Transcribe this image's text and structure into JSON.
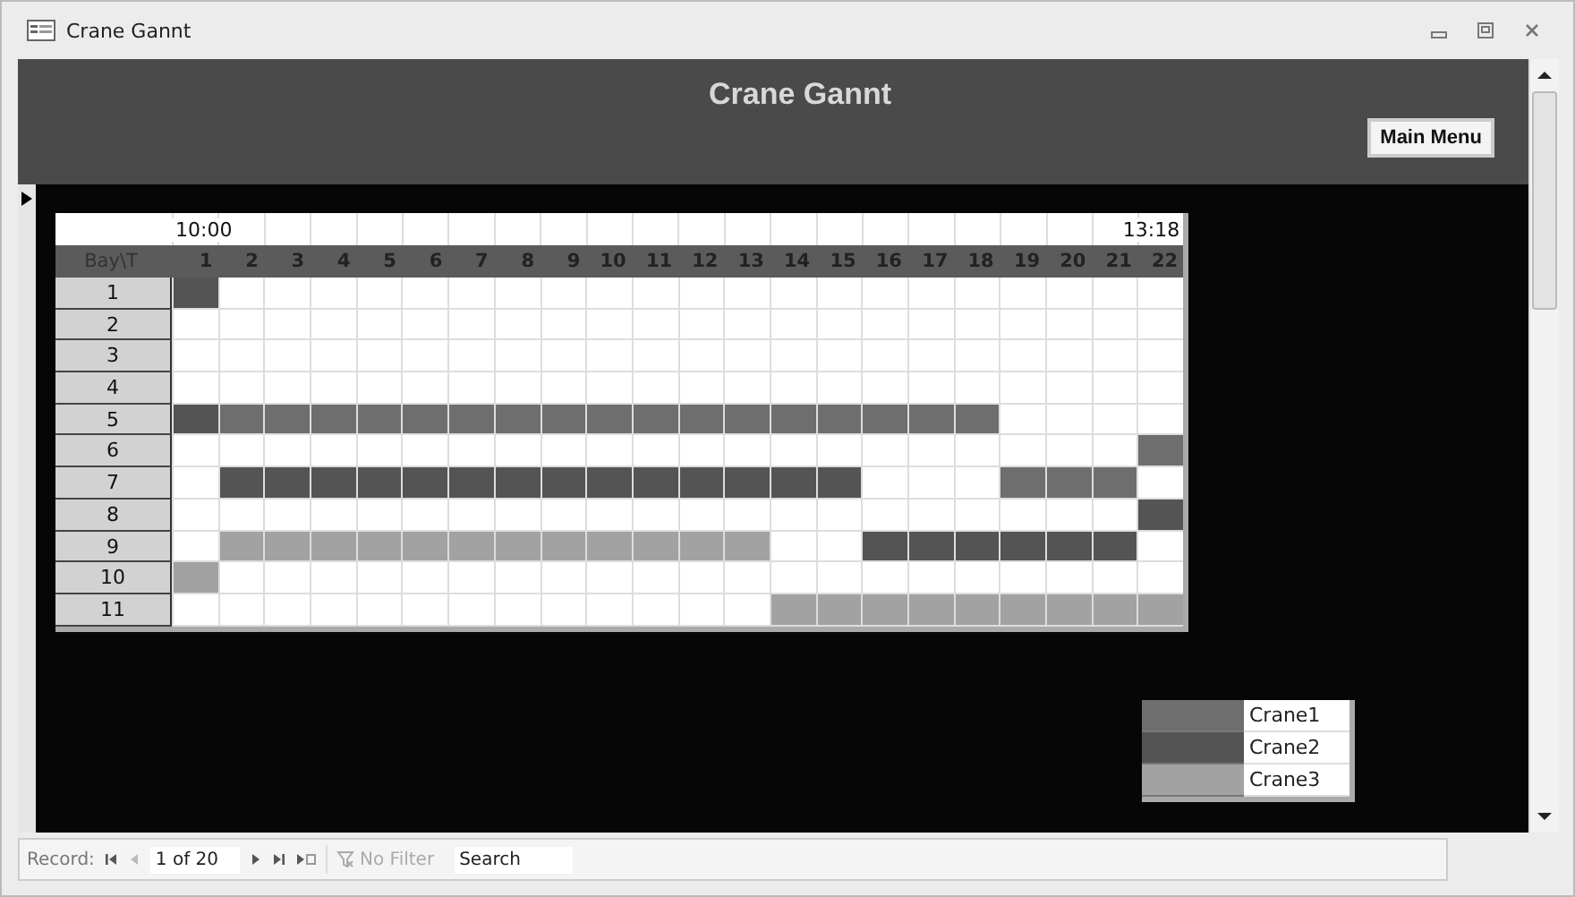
{
  "window": {
    "title": "Crane Gannt"
  },
  "header": {
    "title": "Crane Gannt",
    "button": "Main Menu"
  },
  "gantt": {
    "corner": "Bay\\T",
    "start_time": "10:00",
    "end_time": "13:18",
    "columns": [
      "1",
      "2",
      "3",
      "4",
      "5",
      "6",
      "7",
      "8",
      "9",
      "10",
      "11",
      "12",
      "13",
      "14",
      "15",
      "16",
      "17",
      "18",
      "19",
      "20",
      "21",
      "22"
    ],
    "rows": [
      {
        "label": "1",
        "cells": [
          {
            "color": "#545454"
          },
          {
            "color": "#ffffff"
          },
          {
            "color": "#ffffff"
          },
          {
            "color": "#ffffff"
          },
          {
            "color": "#ffffff"
          },
          {
            "color": "#ffffff"
          },
          {
            "color": "#ffffff"
          },
          {
            "color": "#ffffff"
          },
          {
            "color": "#ffffff"
          },
          {
            "color": "#ffffff"
          },
          {
            "color": "#ffffff"
          },
          {
            "color": "#ffffff"
          },
          {
            "color": "#ffffff"
          },
          {
            "color": "#ffffff"
          },
          {
            "color": "#ffffff"
          },
          {
            "color": "#ffffff"
          },
          {
            "color": "#ffffff"
          },
          {
            "color": "#ffffff"
          },
          {
            "color": "#ffffff"
          },
          {
            "color": "#ffffff"
          },
          {
            "color": "#ffffff"
          },
          {
            "color": "#ffffff"
          }
        ]
      },
      {
        "label": "2",
        "cells": [
          {
            "color": "#ffffff"
          },
          {
            "color": "#ffffff"
          },
          {
            "color": "#ffffff"
          },
          {
            "color": "#ffffff"
          },
          {
            "color": "#ffffff"
          },
          {
            "color": "#ffffff"
          },
          {
            "color": "#ffffff"
          },
          {
            "color": "#ffffff"
          },
          {
            "color": "#ffffff"
          },
          {
            "color": "#ffffff"
          },
          {
            "color": "#ffffff"
          },
          {
            "color": "#ffffff"
          },
          {
            "color": "#ffffff"
          },
          {
            "color": "#ffffff"
          },
          {
            "color": "#ffffff"
          },
          {
            "color": "#ffffff"
          },
          {
            "color": "#ffffff"
          },
          {
            "color": "#ffffff"
          },
          {
            "color": "#ffffff"
          },
          {
            "color": "#ffffff"
          },
          {
            "color": "#ffffff"
          },
          {
            "color": "#ffffff"
          }
        ]
      },
      {
        "label": "3",
        "cells": [
          {
            "color": "#ffffff"
          },
          {
            "color": "#ffffff"
          },
          {
            "color": "#ffffff"
          },
          {
            "color": "#ffffff"
          },
          {
            "color": "#ffffff"
          },
          {
            "color": "#ffffff"
          },
          {
            "color": "#ffffff"
          },
          {
            "color": "#ffffff"
          },
          {
            "color": "#ffffff"
          },
          {
            "color": "#ffffff"
          },
          {
            "color": "#ffffff"
          },
          {
            "color": "#ffffff"
          },
          {
            "color": "#ffffff"
          },
          {
            "color": "#ffffff"
          },
          {
            "color": "#ffffff"
          },
          {
            "color": "#ffffff"
          },
          {
            "color": "#ffffff"
          },
          {
            "color": "#ffffff"
          },
          {
            "color": "#ffffff"
          },
          {
            "color": "#ffffff"
          },
          {
            "color": "#ffffff"
          },
          {
            "color": "#ffffff"
          }
        ]
      },
      {
        "label": "4",
        "cells": [
          {
            "color": "#ffffff"
          },
          {
            "color": "#ffffff"
          },
          {
            "color": "#ffffff"
          },
          {
            "color": "#ffffff"
          },
          {
            "color": "#ffffff"
          },
          {
            "color": "#ffffff"
          },
          {
            "color": "#ffffff"
          },
          {
            "color": "#ffffff"
          },
          {
            "color": "#ffffff"
          },
          {
            "color": "#ffffff"
          },
          {
            "color": "#ffffff"
          },
          {
            "color": "#ffffff"
          },
          {
            "color": "#ffffff"
          },
          {
            "color": "#ffffff"
          },
          {
            "color": "#ffffff"
          },
          {
            "color": "#ffffff"
          },
          {
            "color": "#ffffff"
          },
          {
            "color": "#ffffff"
          },
          {
            "color": "#ffffff"
          },
          {
            "color": "#ffffff"
          },
          {
            "color": "#ffffff"
          },
          {
            "color": "#ffffff"
          }
        ]
      },
      {
        "label": "5",
        "cells": [
          {
            "color": "#545454"
          },
          {
            "color": "#6e6e6e"
          },
          {
            "color": "#6e6e6e"
          },
          {
            "color": "#6e6e6e"
          },
          {
            "color": "#6e6e6e"
          },
          {
            "color": "#6e6e6e"
          },
          {
            "color": "#6e6e6e"
          },
          {
            "color": "#6e6e6e"
          },
          {
            "color": "#6e6e6e"
          },
          {
            "color": "#6e6e6e"
          },
          {
            "color": "#6e6e6e"
          },
          {
            "color": "#6e6e6e"
          },
          {
            "color": "#6e6e6e"
          },
          {
            "color": "#6e6e6e"
          },
          {
            "color": "#6e6e6e"
          },
          {
            "color": "#6e6e6e"
          },
          {
            "color": "#6e6e6e"
          },
          {
            "color": "#6e6e6e"
          },
          {
            "color": "#ffffff"
          },
          {
            "color": "#ffffff"
          },
          {
            "color": "#ffffff"
          },
          {
            "color": "#ffffff"
          }
        ]
      },
      {
        "label": "6",
        "cells": [
          {
            "color": "#ffffff"
          },
          {
            "color": "#ffffff"
          },
          {
            "color": "#ffffff"
          },
          {
            "color": "#ffffff"
          },
          {
            "color": "#ffffff"
          },
          {
            "color": "#ffffff"
          },
          {
            "color": "#ffffff"
          },
          {
            "color": "#ffffff"
          },
          {
            "color": "#ffffff"
          },
          {
            "color": "#ffffff"
          },
          {
            "color": "#ffffff"
          },
          {
            "color": "#ffffff"
          },
          {
            "color": "#ffffff"
          },
          {
            "color": "#ffffff"
          },
          {
            "color": "#ffffff"
          },
          {
            "color": "#ffffff"
          },
          {
            "color": "#ffffff"
          },
          {
            "color": "#ffffff"
          },
          {
            "color": "#ffffff"
          },
          {
            "color": "#ffffff"
          },
          {
            "color": "#ffffff"
          },
          {
            "color": "#6e6e6e"
          }
        ]
      },
      {
        "label": "7",
        "cells": [
          {
            "color": "#ffffff"
          },
          {
            "color": "#545454"
          },
          {
            "color": "#545454"
          },
          {
            "color": "#545454"
          },
          {
            "color": "#545454"
          },
          {
            "color": "#545454"
          },
          {
            "color": "#545454"
          },
          {
            "color": "#545454"
          },
          {
            "color": "#545454"
          },
          {
            "color": "#545454"
          },
          {
            "color": "#545454"
          },
          {
            "color": "#545454"
          },
          {
            "color": "#545454"
          },
          {
            "color": "#545454"
          },
          {
            "color": "#545454"
          },
          {
            "color": "#ffffff"
          },
          {
            "color": "#ffffff"
          },
          {
            "color": "#ffffff"
          },
          {
            "color": "#6e6e6e"
          },
          {
            "color": "#6e6e6e"
          },
          {
            "color": "#6e6e6e"
          },
          {
            "color": "#ffffff"
          }
        ]
      },
      {
        "label": "8",
        "cells": [
          {
            "color": "#ffffff"
          },
          {
            "color": "#ffffff"
          },
          {
            "color": "#ffffff"
          },
          {
            "color": "#ffffff"
          },
          {
            "color": "#ffffff"
          },
          {
            "color": "#ffffff"
          },
          {
            "color": "#ffffff"
          },
          {
            "color": "#ffffff"
          },
          {
            "color": "#ffffff"
          },
          {
            "color": "#ffffff"
          },
          {
            "color": "#ffffff"
          },
          {
            "color": "#ffffff"
          },
          {
            "color": "#ffffff"
          },
          {
            "color": "#ffffff"
          },
          {
            "color": "#ffffff"
          },
          {
            "color": "#ffffff"
          },
          {
            "color": "#ffffff"
          },
          {
            "color": "#ffffff"
          },
          {
            "color": "#ffffff"
          },
          {
            "color": "#ffffff"
          },
          {
            "color": "#ffffff"
          },
          {
            "color": "#545454"
          }
        ]
      },
      {
        "label": "9",
        "cells": [
          {
            "color": "#ffffff"
          },
          {
            "color": "#a2a2a2"
          },
          {
            "color": "#a2a2a2"
          },
          {
            "color": "#a2a2a2"
          },
          {
            "color": "#a2a2a2"
          },
          {
            "color": "#a2a2a2"
          },
          {
            "color": "#a2a2a2"
          },
          {
            "color": "#a2a2a2"
          },
          {
            "color": "#a2a2a2"
          },
          {
            "color": "#a2a2a2"
          },
          {
            "color": "#a2a2a2"
          },
          {
            "color": "#a2a2a2"
          },
          {
            "color": "#a2a2a2"
          },
          {
            "color": "#ffffff"
          },
          {
            "color": "#ffffff"
          },
          {
            "color": "#545454"
          },
          {
            "color": "#545454"
          },
          {
            "color": "#545454"
          },
          {
            "color": "#545454"
          },
          {
            "color": "#545454"
          },
          {
            "color": "#545454"
          },
          {
            "color": "#ffffff"
          }
        ]
      },
      {
        "label": "10",
        "cells": [
          {
            "color": "#a2a2a2"
          },
          {
            "color": "#ffffff"
          },
          {
            "color": "#ffffff"
          },
          {
            "color": "#ffffff"
          },
          {
            "color": "#ffffff"
          },
          {
            "color": "#ffffff"
          },
          {
            "color": "#ffffff"
          },
          {
            "color": "#ffffff"
          },
          {
            "color": "#ffffff"
          },
          {
            "color": "#ffffff"
          },
          {
            "color": "#ffffff"
          },
          {
            "color": "#ffffff"
          },
          {
            "color": "#ffffff"
          },
          {
            "color": "#ffffff"
          },
          {
            "color": "#ffffff"
          },
          {
            "color": "#ffffff"
          },
          {
            "color": "#ffffff"
          },
          {
            "color": "#ffffff"
          },
          {
            "color": "#ffffff"
          },
          {
            "color": "#ffffff"
          },
          {
            "color": "#ffffff"
          },
          {
            "color": "#ffffff"
          }
        ]
      },
      {
        "label": "11",
        "cells": [
          {
            "color": "#ffffff"
          },
          {
            "color": "#ffffff"
          },
          {
            "color": "#ffffff"
          },
          {
            "color": "#ffffff"
          },
          {
            "color": "#ffffff"
          },
          {
            "color": "#ffffff"
          },
          {
            "color": "#ffffff"
          },
          {
            "color": "#ffffff"
          },
          {
            "color": "#ffffff"
          },
          {
            "color": "#ffffff"
          },
          {
            "color": "#ffffff"
          },
          {
            "color": "#ffffff"
          },
          {
            "color": "#ffffff"
          },
          {
            "color": "#a2a2a2"
          },
          {
            "color": "#a2a2a2"
          },
          {
            "color": "#a2a2a2"
          },
          {
            "color": "#a2a2a2"
          },
          {
            "color": "#a2a2a2"
          },
          {
            "color": "#a2a2a2"
          },
          {
            "color": "#a2a2a2"
          },
          {
            "color": "#a2a2a2"
          },
          {
            "color": "#a2a2a2"
          }
        ]
      }
    ]
  },
  "legend": [
    {
      "name": "Crane1",
      "color": "#6e6e6e"
    },
    {
      "name": "Crane2",
      "color": "#545454"
    },
    {
      "name": "Crane3",
      "color": "#a2a2a2"
    }
  ],
  "navigation": {
    "label": "Record:",
    "position": "1 of 20",
    "filter": "No Filter",
    "search_placeholder": "Search"
  }
}
